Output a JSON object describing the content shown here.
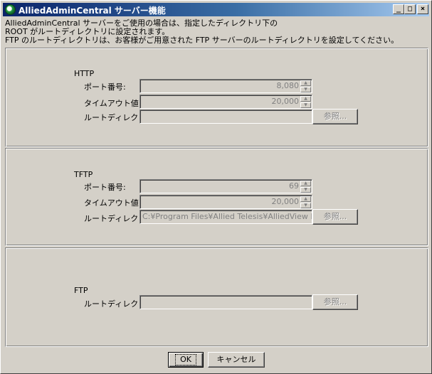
{
  "window": {
    "title": "AlliedAdminCentral サーバー機能",
    "minimize_glyph": "_",
    "maximize_glyph": "□",
    "close_glyph": "×"
  },
  "description": {
    "line1": "AlliedAdminCentral サーバーをご使用の場合は、指定したディレクトリ下の",
    "line2": "ROOT がルートディレクトリに設定されます。",
    "line3": "FTP のルートディレクトリは、お客様がご用意された FTP サーバーのルートディレクトリを設定してください。"
  },
  "http": {
    "heading": "HTTP",
    "port_label": "ポート番号:",
    "port_value": "8,080",
    "timeout_label": "タイムアウト値:",
    "timeout_value": "20,000",
    "root_label": "ルートディレクトリ:",
    "root_value": "",
    "browse_label": "参照..."
  },
  "tftp": {
    "heading": "TFTP",
    "port_label": "ポート番号:",
    "port_value": "69",
    "timeout_label": "タイムアウト値:",
    "timeout_value": "20,000",
    "root_label": "ルートディレクトリ:",
    "root_value": "C:¥Program Files¥Allied Telesis¥AlliedView N",
    "browse_label": "参照..."
  },
  "ftp": {
    "heading": "FTP",
    "root_label": "ルートディレクトリ:",
    "root_value": "",
    "browse_label": "参照..."
  },
  "footer": {
    "ok_label": "OK",
    "cancel_label": "キャンセル"
  }
}
